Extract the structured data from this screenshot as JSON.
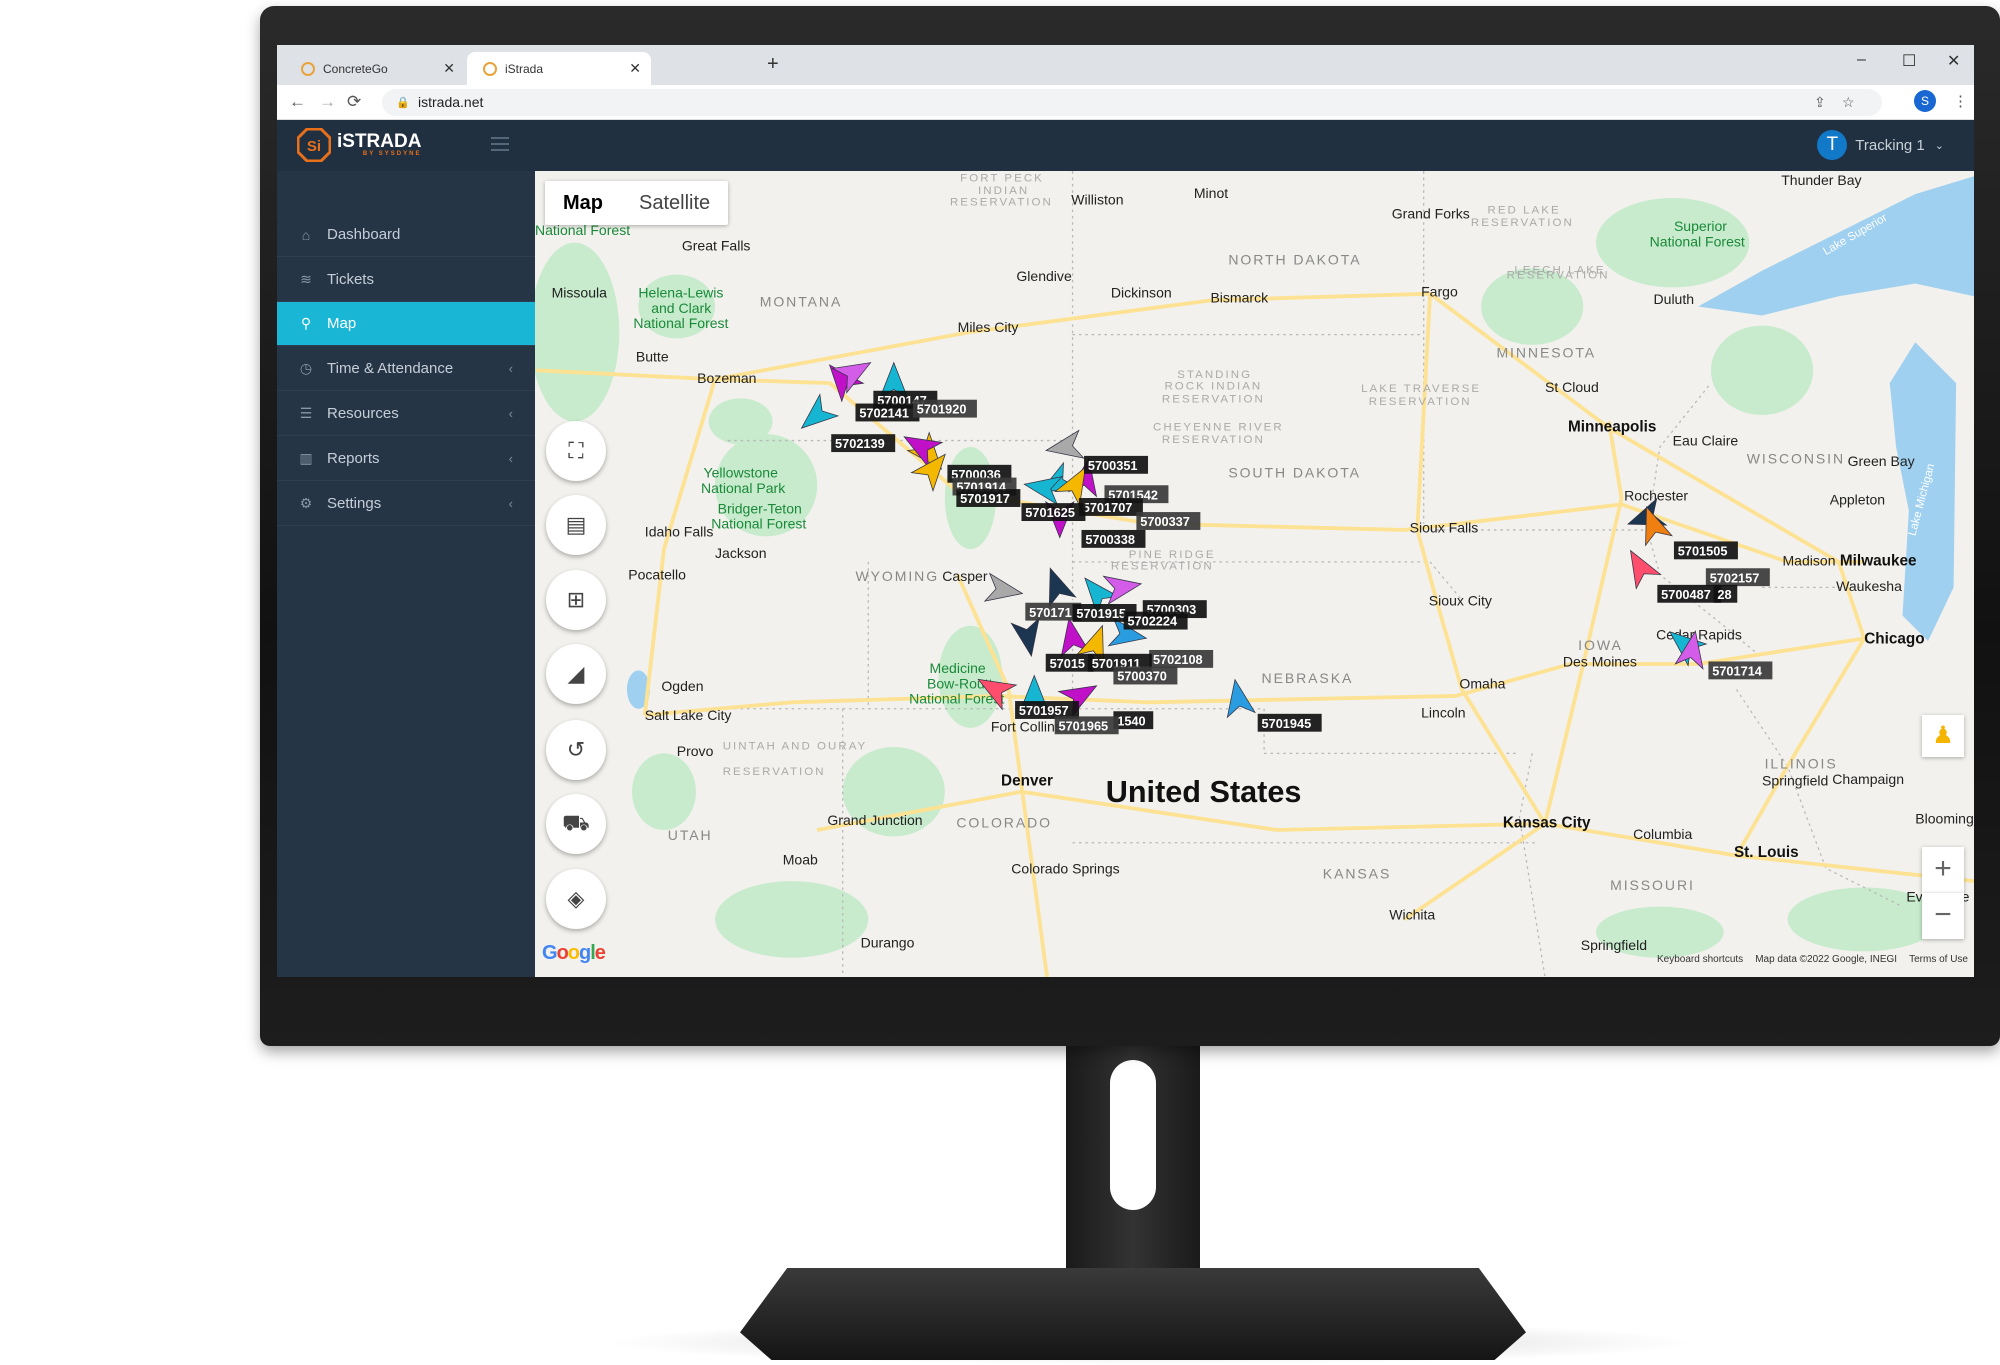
{
  "browser": {
    "tabs": [
      {
        "title": "ConcreteGo",
        "active": false
      },
      {
        "title": "iStrada",
        "active": true
      }
    ],
    "url": "istrada.net",
    "profile_initial": "S"
  },
  "app": {
    "logo": "iSTRADA",
    "logo_sub": "BY SYSDYNE",
    "user": {
      "initial": "T",
      "name": "Tracking 1"
    },
    "accent": "#1ab6d6"
  },
  "sidebar": {
    "items": [
      {
        "label": "Dashboard",
        "icon": "home-icon"
      },
      {
        "label": "Tickets",
        "icon": "layers-icon"
      },
      {
        "label": "Map",
        "icon": "map-pin-icon",
        "active": true
      },
      {
        "label": "Time & Attendance",
        "icon": "clock-icon",
        "expandable": true
      },
      {
        "label": "Resources",
        "icon": "database-icon",
        "expandable": true
      },
      {
        "label": "Reports",
        "icon": "bar-chart-icon",
        "expandable": true
      },
      {
        "label": "Settings",
        "icon": "gear-icon",
        "expandable": true
      }
    ]
  },
  "map": {
    "type_toggle": {
      "map": "Map",
      "satellite": "Satellite",
      "selected": "Map"
    },
    "controls": [
      "fullscreen-icon",
      "message-icon",
      "map-icon",
      "area-chart-icon",
      "history-icon",
      "truck-icon",
      "layers-icon"
    ],
    "zoom_in": "+",
    "zoom_out": "−",
    "google": "Google",
    "attribution": {
      "shortcuts": "Keyboard shortcuts",
      "data": "Map data ©2022 Google, INEGI",
      "terms": "Terms of Use"
    },
    "country": "United States",
    "places": [
      "MONTANA",
      "NORTH DAKOTA",
      "SOUTH DAKOTA",
      "WYOMING",
      "NEBRASKA",
      "IOWA",
      "MINNESOTA",
      "WISCONSIN",
      "COLORADO",
      "UTAH",
      "KANSAS",
      "MISSOURI",
      "ILLINOIS",
      "Great Falls",
      "Butte",
      "Bozeman",
      "Missoula",
      "Idaho Falls",
      "Pocatello",
      "Jackson",
      "Ogden",
      "Salt Lake City",
      "Provo",
      "Casper",
      "Denver",
      "Fort Collins",
      "Colorado Springs",
      "Grand Junction",
      "Moab",
      "Durango",
      "Williston",
      "Minot",
      "Glendive",
      "Miles City",
      "Dickinson",
      "Bismarck",
      "Fargo",
      "Grand Forks",
      "Sioux Falls",
      "Sioux City",
      "Omaha",
      "Lincoln",
      "Des Moines",
      "Cedar Rapids",
      "Kansas City",
      "Columbia",
      "St. Louis",
      "Wichita",
      "Springfield",
      "Minneapolis",
      "St Cloud",
      "Rochester",
      "Eau Claire",
      "Green Bay",
      "Appleton",
      "Madison",
      "Milwaukee",
      "Waukesha",
      "Chicago",
      "Springfield",
      "Champaign",
      "Bloomington",
      "Evansville",
      "Duluth",
      "Thunder Bay",
      "Helena-Lewis",
      "and Clark",
      "National Forest",
      "Yellowstone",
      "National Park",
      "Bridger-Teton",
      "National Forest",
      "Medicine",
      "Bow-Routt",
      "National Forest",
      "Superior",
      "National Forest",
      "National Forest",
      "Lake Superior",
      "Lake Michigan",
      "FORT PECK",
      "INDIAN",
      "RESERVATION",
      "STANDING",
      "ROCK INDIAN",
      "RESERVATION",
      "CHEYENNE RIVER",
      "RESERVATION",
      "PINE RIDGE",
      "RESERVATION",
      "LAKE TRAVERSE",
      "RESERVATION",
      "RED LAKE",
      "RESERVATION",
      "LEECH LAKE",
      "RESERVATION",
      "UINTAH AND OURAY",
      "RESERVATION"
    ],
    "vehicles": [
      "5700147",
      "5702141",
      "5701920",
      "5702139",
      "5700036",
      "5701914",
      "5701917",
      "5700351",
      "5701542",
      "5701707",
      "5701625",
      "5700337",
      "5700338",
      "5700303",
      "570171",
      "5701915",
      "5702224",
      "5702108",
      "57015",
      "5701911",
      "5700370",
      "5701957",
      "1540",
      "5701965",
      "5701945",
      "5701505",
      "5702157",
      "5700487",
      "28",
      "5701714"
    ],
    "markers": [
      {
        "color": "#c011c8",
        "heading": -40
      },
      {
        "color": "#d35ce8",
        "heading": 60
      },
      {
        "color": "#16b6d2",
        "heading": -130
      },
      {
        "color": "#16b6d2",
        "heading": 0
      },
      {
        "color": "#f5b800",
        "heading": 140
      },
      {
        "color": "#c011c8",
        "heading": -60
      },
      {
        "color": "#f5b800",
        "heading": 40
      },
      {
        "color": "#a9a9a9",
        "heading": -100
      },
      {
        "color": "#16b6d2",
        "heading": -120
      },
      {
        "color": "#16b6d2",
        "heading": -80
      },
      {
        "color": "#c011c8",
        "heading": 10
      },
      {
        "color": "#c011c8",
        "heading": 180
      },
      {
        "color": "#f5b800",
        "heading": 30
      },
      {
        "color": "#a9a9a9",
        "heading": 100
      },
      {
        "color": "#1c3550",
        "heading": -20
      },
      {
        "color": "#16b6d2",
        "heading": -40
      },
      {
        "color": "#d35ce8",
        "heading": 80
      },
      {
        "color": "#1c3550",
        "heading": 170
      },
      {
        "color": "#c011c8",
        "heading": -10
      },
      {
        "color": "#f5b800",
        "heading": 20
      },
      {
        "color": "#2a9de0",
        "heading": 100
      },
      {
        "color": "#ff4d6d",
        "heading": -60
      },
      {
        "color": "#16b6d2",
        "heading": 0
      },
      {
        "color": "#c011c8",
        "heading": 60
      },
      {
        "color": "#2a9de0",
        "heading": -10
      },
      {
        "color": "#1c3550",
        "heading": -110
      },
      {
        "color": "#f07f12",
        "heading": -20
      },
      {
        "color": "#ff4d6d",
        "heading": -30
      },
      {
        "color": "#16b6d2",
        "heading": -50
      },
      {
        "color": "#d35ce8",
        "heading": 10
      }
    ]
  }
}
